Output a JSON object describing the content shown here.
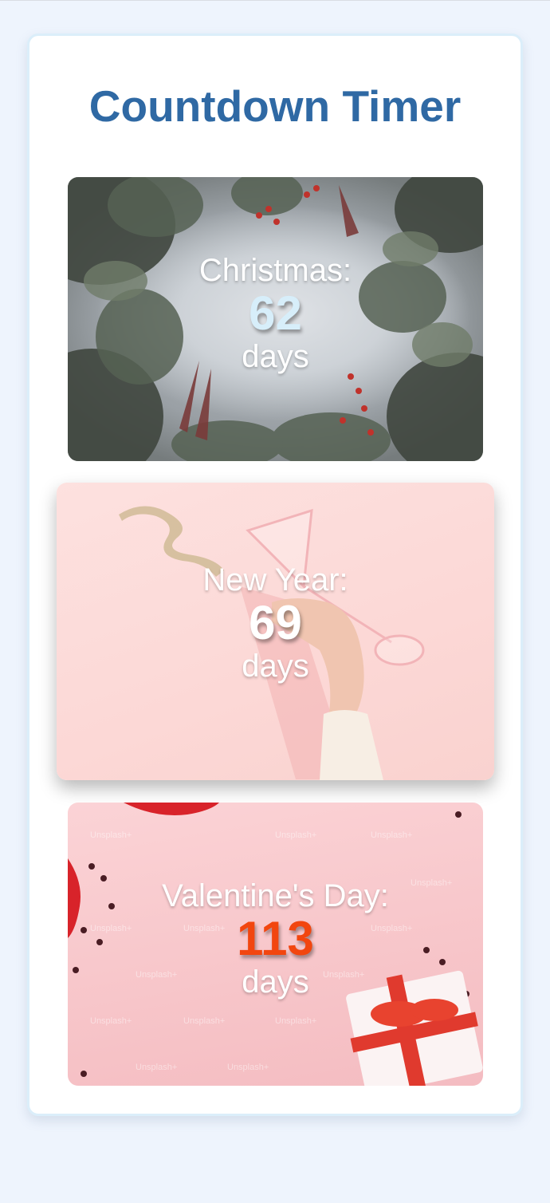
{
  "page": {
    "title": "Countdown Timer"
  },
  "events": [
    {
      "name": "Christmas:",
      "count": "62",
      "unit": "days",
      "count_color": "#d7eefa"
    },
    {
      "name": "New Year:",
      "count": "69",
      "unit": "days",
      "count_color": "#ffffff"
    },
    {
      "name": "Valentine's Day:",
      "count": "113",
      "unit": "days",
      "count_color": "#f2460f"
    }
  ],
  "watermark": "Unsplash+",
  "colors": {
    "page_background": "#eef4fd",
    "title": "#2f69a4",
    "card_text": "#ffffff"
  }
}
